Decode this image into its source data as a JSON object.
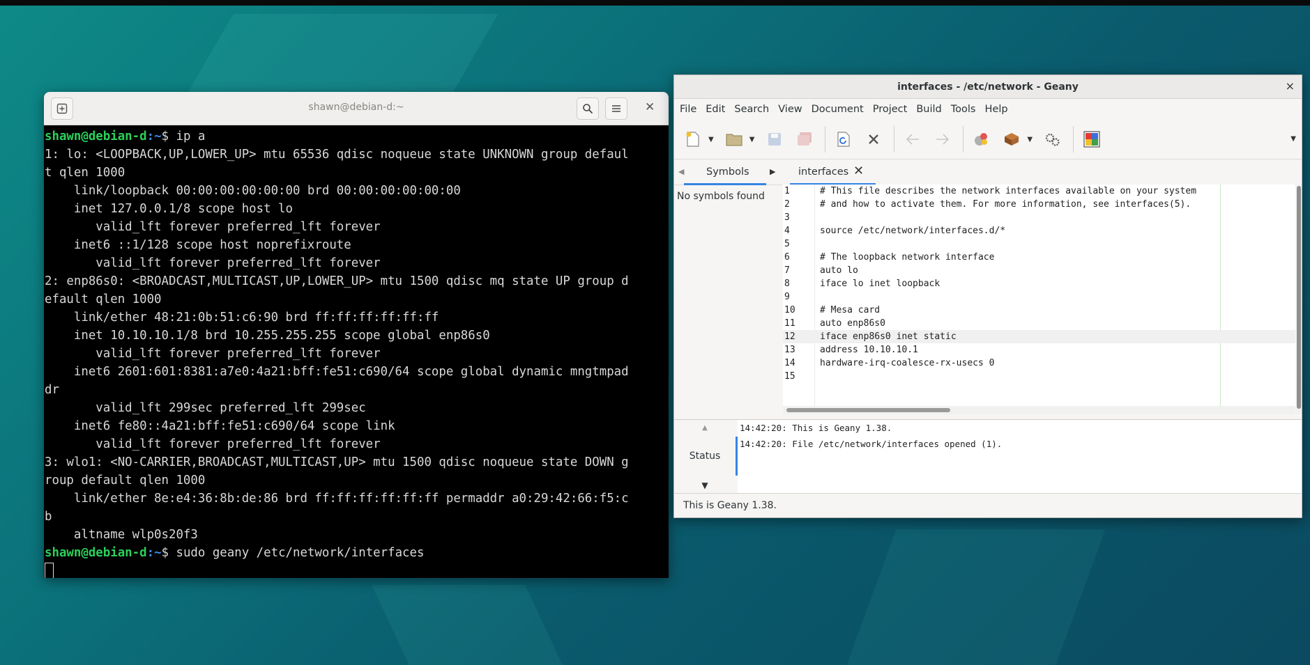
{
  "terminal": {
    "title": "shawn@debian-d:~",
    "lines": [
      {
        "user": "shawn@debian-d",
        "path": ":~",
        "cmd": "$ ip a"
      },
      {
        "text": "1: lo: <LOOPBACK,UP,LOWER_UP> mtu 65536 qdisc noqueue state UNKNOWN group defaul"
      },
      {
        "text": "t qlen 1000"
      },
      {
        "text": "    link/loopback 00:00:00:00:00:00 brd 00:00:00:00:00:00"
      },
      {
        "text": "    inet 127.0.0.1/8 scope host lo"
      },
      {
        "text": "       valid_lft forever preferred_lft forever"
      },
      {
        "text": "    inet6 ::1/128 scope host noprefixroute"
      },
      {
        "text": "       valid_lft forever preferred_lft forever"
      },
      {
        "text": "2: enp86s0: <BROADCAST,MULTICAST,UP,LOWER_UP> mtu 1500 qdisc mq state UP group d"
      },
      {
        "text": "efault qlen 1000"
      },
      {
        "text": "    link/ether 48:21:0b:51:c6:90 brd ff:ff:ff:ff:ff:ff"
      },
      {
        "text": "    inet 10.10.10.1/8 brd 10.255.255.255 scope global enp86s0"
      },
      {
        "text": "       valid_lft forever preferred_lft forever"
      },
      {
        "text": "    inet6 2601:601:8381:a7e0:4a21:bff:fe51:c690/64 scope global dynamic mngtmpad"
      },
      {
        "text": "dr"
      },
      {
        "text": "       valid_lft 299sec preferred_lft 299sec"
      },
      {
        "text": "    inet6 fe80::4a21:bff:fe51:c690/64 scope link"
      },
      {
        "text": "       valid_lft forever preferred_lft forever"
      },
      {
        "text": "3: wlo1: <NO-CARRIER,BROADCAST,MULTICAST,UP> mtu 1500 qdisc noqueue state DOWN g"
      },
      {
        "text": "roup default qlen 1000"
      },
      {
        "text": "    link/ether 8e:e4:36:8b:de:86 brd ff:ff:ff:ff:ff:ff permaddr a0:29:42:66:f5:c"
      },
      {
        "text": "b"
      },
      {
        "text": "    altname wlp0s20f3"
      },
      {
        "user": "shawn@debian-d",
        "path": ":~",
        "cmd": "$ sudo geany /etc/network/interfaces"
      }
    ]
  },
  "geany": {
    "title": "interfaces - /etc/network - Geany",
    "close_glyph": "×",
    "menu": [
      "File",
      "Edit",
      "Search",
      "View",
      "Document",
      "Project",
      "Build",
      "Tools",
      "Help"
    ],
    "sidebar": {
      "tab_label": "Symbols",
      "empty_text": "No symbols found"
    },
    "editor": {
      "tab_label": "interfaces",
      "current_line": 12,
      "lines": [
        {
          "n": "1",
          "t": "# This file describes the network interfaces available on your system"
        },
        {
          "n": "2",
          "t": "# and how to activate them. For more information, see interfaces(5)."
        },
        {
          "n": "3",
          "t": ""
        },
        {
          "n": "4",
          "t": "source /etc/network/interfaces.d/*"
        },
        {
          "n": "5",
          "t": ""
        },
        {
          "n": "6",
          "t": "# The loopback network interface"
        },
        {
          "n": "7",
          "t": "auto lo"
        },
        {
          "n": "8",
          "t": "iface lo inet loopback"
        },
        {
          "n": "9",
          "t": ""
        },
        {
          "n": "10",
          "t": "# Mesa card"
        },
        {
          "n": "11",
          "t": "auto enp86s0"
        },
        {
          "n": "12",
          "t": "iface enp86s0 inet static"
        },
        {
          "n": "13",
          "t": "address 10.10.10.1"
        },
        {
          "n": "14",
          "t": "hardware-irq-coalesce-rx-usecs 0"
        },
        {
          "n": "15",
          "t": ""
        }
      ]
    },
    "messages": {
      "tab_label": "Status",
      "lines": [
        "14:42:20: This is Geany 1.38.",
        "14:42:20: File /etc/network/interfaces opened (1)."
      ]
    },
    "statusbar": "This is Geany 1.38."
  }
}
